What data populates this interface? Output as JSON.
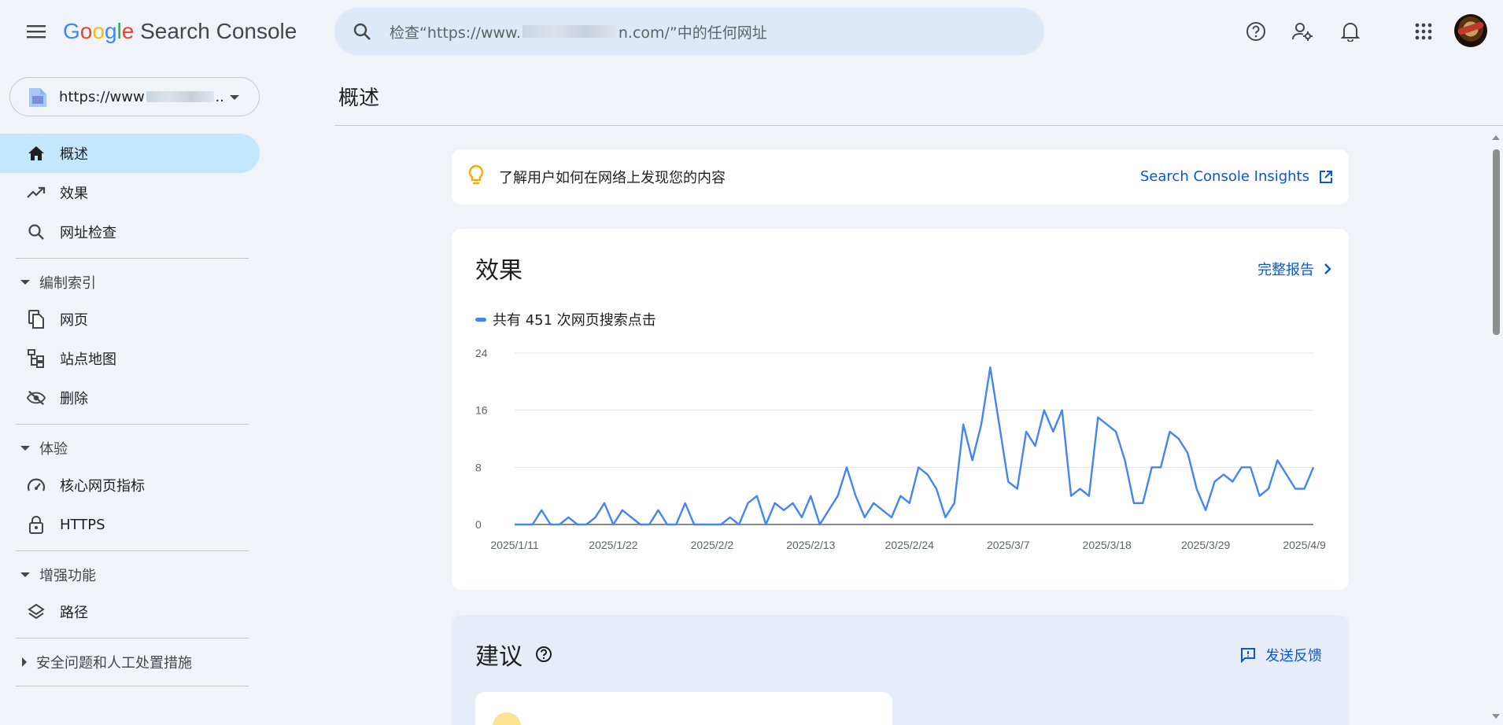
{
  "app": {
    "logo_google": [
      "G",
      "o",
      "o",
      "g",
      "l",
      "e"
    ],
    "logo_product": "Search Console"
  },
  "search": {
    "placeholder_prefix": "检查“https://www.",
    "placeholder_suffix": "n.com/”中的任何网址"
  },
  "header_icons": [
    "help-icon",
    "manage-users-icon",
    "notifications-icon",
    "apps-grid-icon"
  ],
  "property": {
    "url_prefix": "https://www",
    "url_suffix": ".."
  },
  "sidebar": {
    "top_items": [
      {
        "label": "概述",
        "icon": "home-icon",
        "active": true
      },
      {
        "label": "效果",
        "icon": "trending-up-icon",
        "active": false
      },
      {
        "label": "网址检查",
        "icon": "search-icon",
        "active": false
      }
    ],
    "groups": [
      {
        "label": "编制索引",
        "expanded": true,
        "items": [
          {
            "label": "网页",
            "icon": "pages-icon"
          },
          {
            "label": "站点地图",
            "icon": "sitemap-icon"
          },
          {
            "label": "删除",
            "icon": "visibility-off-icon"
          }
        ]
      },
      {
        "label": "体验",
        "expanded": true,
        "items": [
          {
            "label": "核心网页指标",
            "icon": "speed-gauge-icon"
          },
          {
            "label": "HTTPS",
            "icon": "lock-icon"
          }
        ]
      },
      {
        "label": "增强功能",
        "expanded": true,
        "items": [
          {
            "label": "路径",
            "icon": "layers-icon"
          }
        ]
      },
      {
        "label": "安全问题和人工处置措施",
        "expanded": false,
        "items": []
      }
    ]
  },
  "main": {
    "page_title": "概述",
    "insight": {
      "text": "了解用户如何在网络上发现您的内容",
      "link": "Search Console Insights"
    },
    "performance": {
      "title": "效果",
      "full_report": "完整报告",
      "legend": "共有 451 次网页搜索点击"
    },
    "suggestions": {
      "title": "建议",
      "feedback": "发送反馈"
    }
  },
  "colors": {
    "accent": "#0b57d0",
    "series": "#4285f4",
    "active_nav": "#c2e7ff",
    "bulb": "#f9ab00"
  },
  "chart_data": {
    "type": "line",
    "ylim": [
      0,
      24
    ],
    "yticks": [
      0,
      8,
      16,
      24
    ],
    "xtick_labels": [
      "2025/1/11",
      "2025/1/22",
      "2025/2/2",
      "2025/2/13",
      "2025/2/24",
      "2025/3/7",
      "2025/3/18",
      "2025/3/29",
      "2025/4/9"
    ],
    "xtick_index": [
      0,
      11,
      22,
      33,
      44,
      55,
      66,
      77,
      88
    ],
    "series": [
      {
        "name": "共有 451 次网页搜索点击",
        "values": [
          0,
          0,
          0,
          2,
          0,
          0,
          1,
          0,
          0,
          1,
          3,
          0,
          2,
          1,
          0,
          0,
          2,
          0,
          0,
          3,
          0,
          0,
          0,
          0,
          1,
          0,
          3,
          4,
          0,
          3,
          2,
          3,
          1,
          4,
          0,
          2,
          4,
          8,
          4,
          1,
          3,
          2,
          1,
          4,
          3,
          8,
          7,
          5,
          1,
          3,
          14,
          9,
          14,
          22,
          14,
          6,
          5,
          13,
          11,
          16,
          13,
          16,
          4,
          5,
          4,
          15,
          14,
          13,
          9,
          3,
          3,
          8,
          8,
          13,
          12,
          10,
          5,
          2,
          6,
          7,
          6,
          8,
          8,
          4,
          5,
          9,
          7,
          5,
          5,
          8
        ]
      }
    ],
    "grid": true
  }
}
